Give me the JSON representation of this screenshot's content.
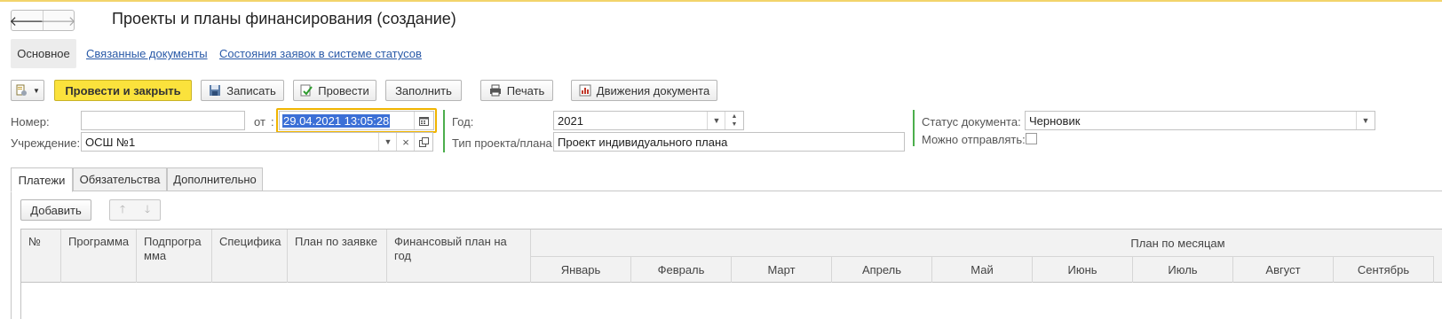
{
  "window": {
    "title": "Проекты и планы финансирования (создание)"
  },
  "top_tabs": {
    "main": "Основное",
    "links": [
      "Связанные документы",
      "Состояния заявок в системе статусов"
    ]
  },
  "toolbar": {
    "post_close": "Провести и закрыть",
    "save": "Записать",
    "post": "Провести",
    "fill": "Заполнить",
    "print": "Печать",
    "movements": "Движения документа"
  },
  "form": {
    "number_label": "Номер:",
    "number_value": "",
    "from_label": "от",
    "colon": ":",
    "date_value": "29.04.2021 13:05:28",
    "institution_label": "Учреждение:",
    "institution_value": "ОСШ №1",
    "year_label": "Год:",
    "year_value": "2021",
    "project_type_label": "Тип проекта/плана:",
    "project_type_value": "Проект индивидуального плана",
    "status_label": "Статус документа:",
    "status_value": "Черновик",
    "can_send_label": "Можно отправлять:",
    "can_send_checked": false
  },
  "lower_tabs": [
    "Платежи",
    "Обязательства",
    "Дополнительно"
  ],
  "table_toolbar": {
    "add": "Добавить"
  },
  "table": {
    "columns": [
      "№",
      "Программа",
      "Подпрограмма",
      "Специфика",
      "План по заявке",
      "Финансовый план на год"
    ],
    "subprogram_line1": "Подпрогра",
    "subprogram_line2": "мма",
    "months_header": "План по месяцам",
    "months": [
      "Январь",
      "Февраль",
      "Март",
      "Апрель",
      "Май",
      "Июнь",
      "Июль",
      "Август",
      "Сентябрь"
    ]
  },
  "colors": {
    "primary_button": "#fbe23c",
    "link": "#2a5aa8",
    "group_separator": "#4cae4c",
    "focus_border": "#f0b400",
    "selection": "#3b6fd6"
  }
}
